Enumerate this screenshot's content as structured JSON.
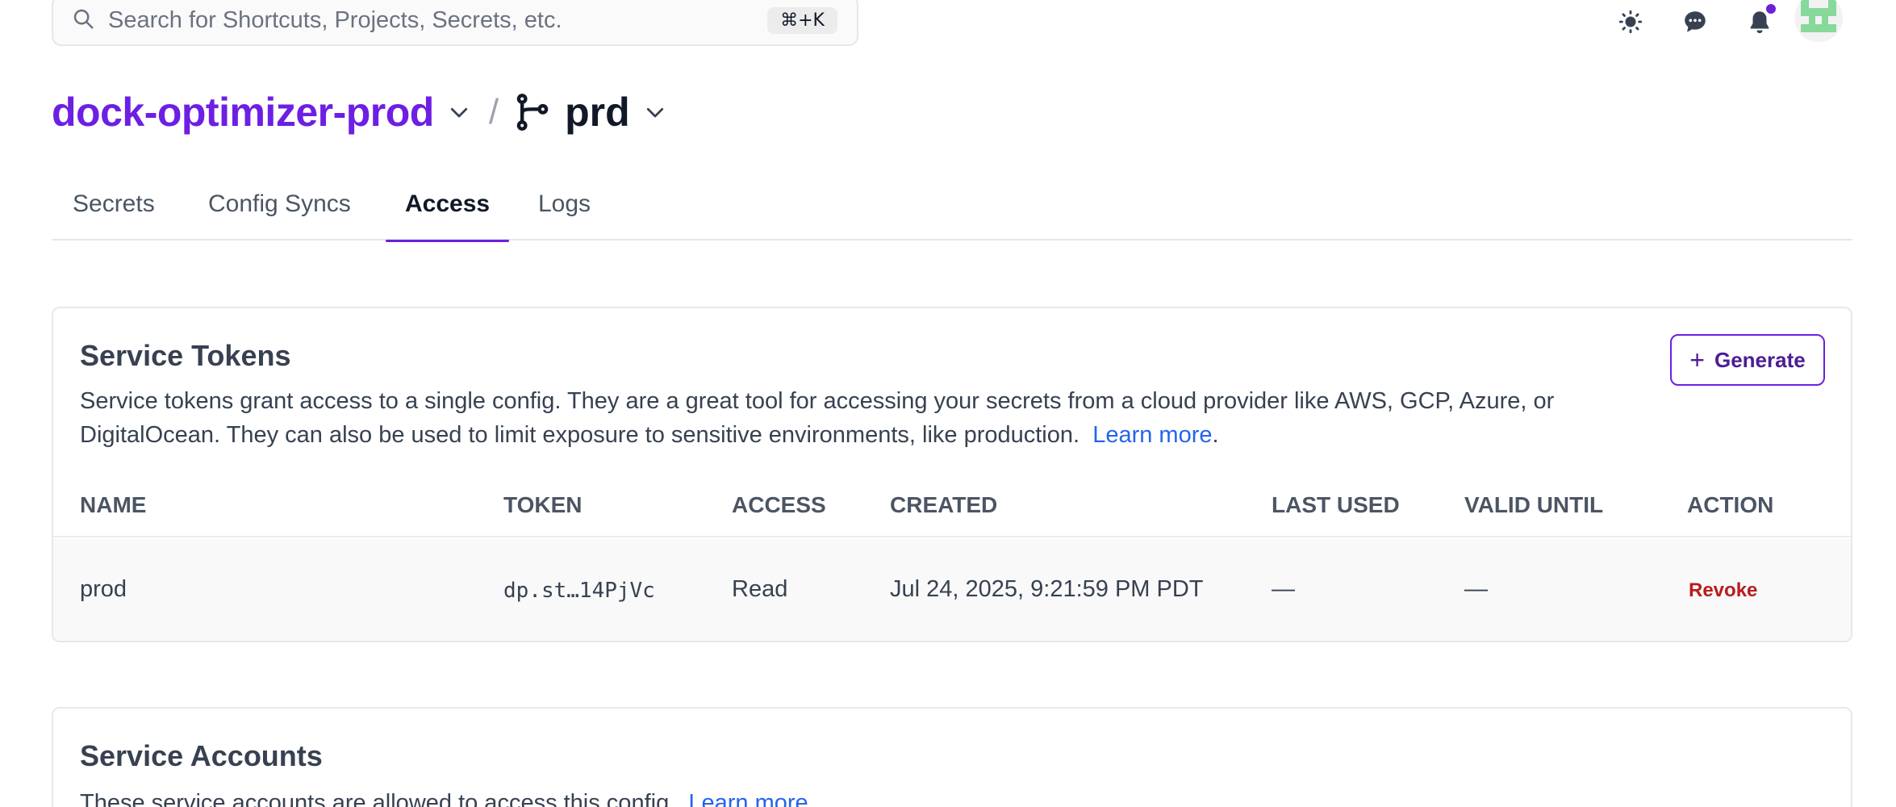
{
  "search": {
    "placeholder": "Search for Shortcuts, Projects, Secrets, etc.",
    "shortcut": "⌘+K"
  },
  "header": {
    "icons": [
      "sun-icon",
      "chat-icon",
      "bell-icon",
      "avatar"
    ],
    "accent_color": "#6d1fe3"
  },
  "breadcrumb": {
    "project": "dock-optimizer-prod",
    "separator": "/",
    "config": "prd"
  },
  "tabs": [
    {
      "label": "Secrets",
      "active": false
    },
    {
      "label": "Config Syncs",
      "active": false
    },
    {
      "label": "Access",
      "active": true
    },
    {
      "label": "Logs",
      "active": false
    }
  ],
  "service_tokens": {
    "title": "Service Tokens",
    "description": "Service tokens grant access to a single config. They are a great tool for accessing your secrets from a cloud provider like AWS, GCP, Azure, or DigitalOcean. They can also be used to limit exposure to sensitive environments, like production.",
    "learn_more": "Learn more",
    "learn_more_suffix": ".",
    "generate_label": "Generate",
    "columns": [
      "NAME",
      "TOKEN",
      "ACCESS",
      "CREATED",
      "LAST USED",
      "VALID UNTIL",
      "ACTION"
    ],
    "rows": [
      {
        "name": "prod",
        "token": "dp.st…14PjVc",
        "access": "Read",
        "created": "Jul 24, 2025, 9:21:59 PM PDT",
        "last_used": "—",
        "valid_until": "—",
        "action": "Revoke"
      }
    ],
    "revoke_color": "#b91c1c"
  },
  "service_accounts": {
    "title": "Service Accounts",
    "description": "These service accounts are allowed to access this config.",
    "learn_more": "Learn more",
    "learn_more_suffix": "."
  }
}
